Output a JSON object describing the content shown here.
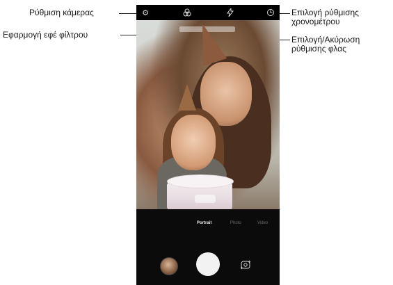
{
  "callouts": {
    "camera_settings": "Ρύθμιση κάμερας",
    "apply_filter": "Εφαρμογή εφέ φίλτρου",
    "timer": [
      "Επιλογή ρύθμισης",
      "χρονομέτρου"
    ],
    "flash": [
      "Επιλογή/Ακύρωση",
      "ρύθμισης φλας"
    ]
  },
  "camera": {
    "top_icons": [
      "gear-icon",
      "filter-icon",
      "flash-icon",
      "timer-icon"
    ],
    "modes": [
      "Portrait",
      "Photo",
      "Video"
    ],
    "active_mode": "Portrait"
  }
}
